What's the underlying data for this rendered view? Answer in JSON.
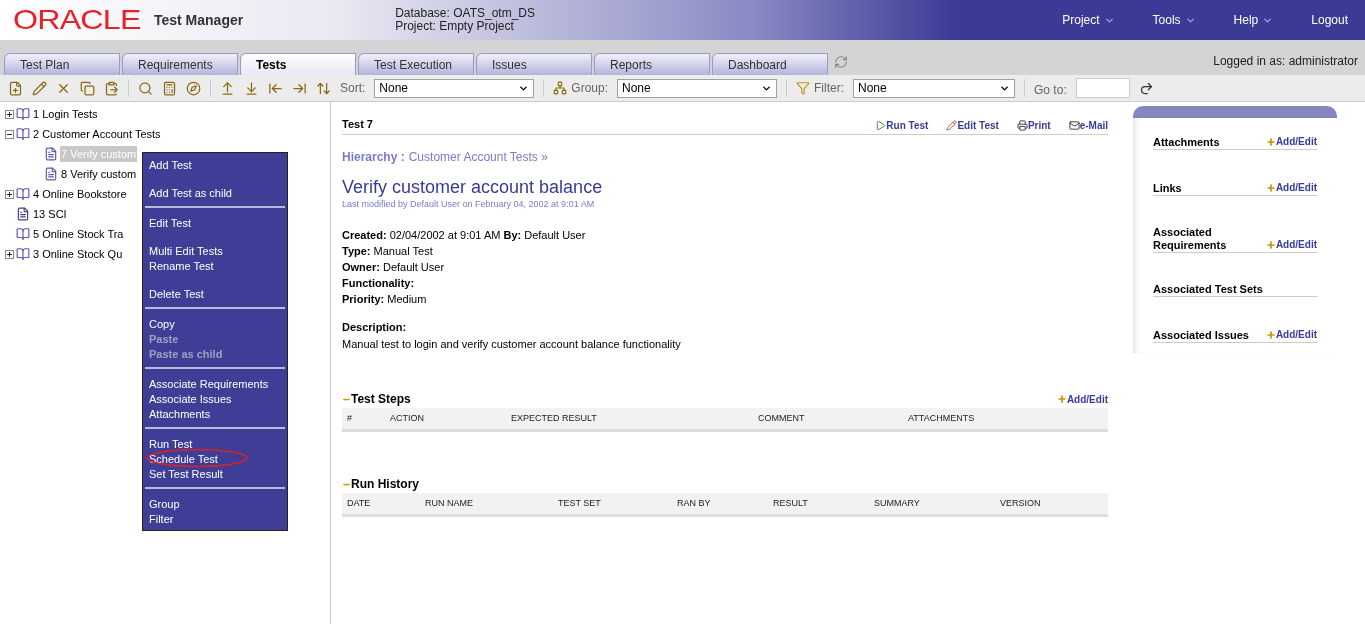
{
  "header": {
    "logo": "ORACLE",
    "app_title": "Test Manager",
    "database": "Database: OATS_otm_DS",
    "project": "Project: Empty Project",
    "menus": [
      {
        "label": "Project",
        "dropdown": true
      },
      {
        "label": "Tools",
        "dropdown": true
      },
      {
        "label": "Help",
        "dropdown": true
      },
      {
        "label": "Logout",
        "dropdown": false
      }
    ]
  },
  "tabs": [
    {
      "label": "Test Plan",
      "selected": false
    },
    {
      "label": "Requirements",
      "selected": false
    },
    {
      "label": "Tests",
      "selected": true
    },
    {
      "label": "Test Execution",
      "selected": false
    },
    {
      "label": "Issues",
      "selected": false
    },
    {
      "label": "Reports",
      "selected": false
    },
    {
      "label": "Dashboard",
      "selected": false
    }
  ],
  "logged_in": "Logged in as: administrator",
  "toolbar": {
    "sort_label": "Sort:",
    "sort_value": "None",
    "group_label": "Group:",
    "group_value": "None",
    "filter_label": "Filter:",
    "filter_value": "None",
    "goto_label": "Go to:"
  },
  "tree": [
    {
      "label": "1 Login Tests",
      "kind": "folder",
      "expanded": false,
      "selected": false
    },
    {
      "label": "2 Customer Account Tests",
      "kind": "folder",
      "expanded": true,
      "selected": false,
      "children": [
        {
          "label": "7 Verify custom",
          "kind": "test",
          "selected": true
        },
        {
          "label": "8 Verify custom",
          "kind": "test",
          "selected": false
        }
      ]
    },
    {
      "label": "4 Online Bookstore",
      "kind": "folder",
      "expanded": false,
      "selected": false
    },
    {
      "label": "13 SCI",
      "kind": "script",
      "selected": false
    },
    {
      "label": "5 Online Stock Tra",
      "kind": "folder",
      "selected": false
    },
    {
      "label": "3 Online Stock Qu",
      "kind": "folder",
      "expanded": false,
      "selected": false
    }
  ],
  "context_menu": [
    [
      [
        {
          "label": "Add Test",
          "disabled": false,
          "circled": false
        }
      ],
      [
        {
          "label": "Add Test as child",
          "disabled": false,
          "circled": false
        }
      ]
    ],
    [
      [
        {
          "label": "Edit Test",
          "disabled": false,
          "circled": false
        }
      ],
      [
        {
          "label": "Multi Edit Tests",
          "disabled": false,
          "circled": false
        },
        {
          "label": "Rename Test",
          "disabled": false,
          "circled": false
        }
      ],
      [
        {
          "label": "Delete Test",
          "disabled": false,
          "circled": false
        }
      ]
    ],
    [
      [
        {
          "label": "Copy",
          "disabled": false,
          "circled": false
        },
        {
          "label": "Paste",
          "disabled": true,
          "circled": false
        },
        {
          "label": "Paste as child",
          "disabled": true,
          "circled": false
        }
      ]
    ],
    [
      [
        {
          "label": "Associate Requirements",
          "disabled": false,
          "circled": false
        },
        {
          "label": "Associate Issues",
          "disabled": false,
          "circled": false
        },
        {
          "label": "Attachments",
          "disabled": false,
          "circled": false
        }
      ]
    ],
    [
      [
        {
          "label": "Run Test",
          "disabled": false,
          "circled": false
        },
        {
          "label": "Schedule Test",
          "disabled": false,
          "circled": true
        },
        {
          "label": "Set Test Result",
          "disabled": false,
          "circled": false
        }
      ]
    ],
    [
      [
        {
          "label": "Group",
          "disabled": false,
          "circled": false
        },
        {
          "label": "Filter",
          "disabled": false,
          "circled": false
        }
      ]
    ]
  ],
  "detail": {
    "id_title": "Test 7",
    "actions": [
      {
        "label": "Run Test",
        "kind": "run"
      },
      {
        "label": "Edit Test",
        "kind": "edit"
      },
      {
        "label": "Print",
        "kind": "print"
      },
      {
        "label": "e-Mail",
        "kind": "mail"
      }
    ],
    "hierarchy_label": "Hierarchy :",
    "hierarchy_link": "Customer Account Tests »",
    "title": "Verify customer account balance",
    "modified": "Last modified by Default User on February 04, 2002 at 9:01 AM",
    "fields": [
      {
        "label": "Created:",
        "value": "02/04/2002 at 9:01 AM",
        "label2": "By:",
        "value2": "Default User"
      },
      {
        "label": "Type:",
        "value": "Manual Test"
      },
      {
        "label": "Owner:",
        "value": "Default User"
      },
      {
        "label": "Functionality:"
      },
      {
        "label": "Priority:",
        "value": "Medium"
      }
    ],
    "description_label": "Description:",
    "description": "Manual test to login and verify customer account balance functionality",
    "sections": [
      {
        "title": "Test Steps",
        "action": "Add/Edit",
        "columns": [
          "#",
          "ACTION",
          "EXPECTED RESULT",
          "COMMENT",
          "ATTACHMENTS"
        ]
      },
      {
        "title": "Run History",
        "columns": [
          "DATE",
          "RUN NAME",
          "TEST SET",
          "RAN BY",
          "RESULT",
          "SUMMARY",
          "VERSION"
        ]
      }
    ]
  },
  "side_panel": [
    {
      "title": "Attachments",
      "action": "Add/Edit"
    },
    {
      "title": "Links",
      "action": "Add/Edit"
    },
    {
      "title": "Associated Requirements",
      "action": "Add/Edit"
    },
    {
      "title": "Associated Test Sets"
    },
    {
      "title": "Associated Issues",
      "action": "Add/Edit"
    }
  ]
}
